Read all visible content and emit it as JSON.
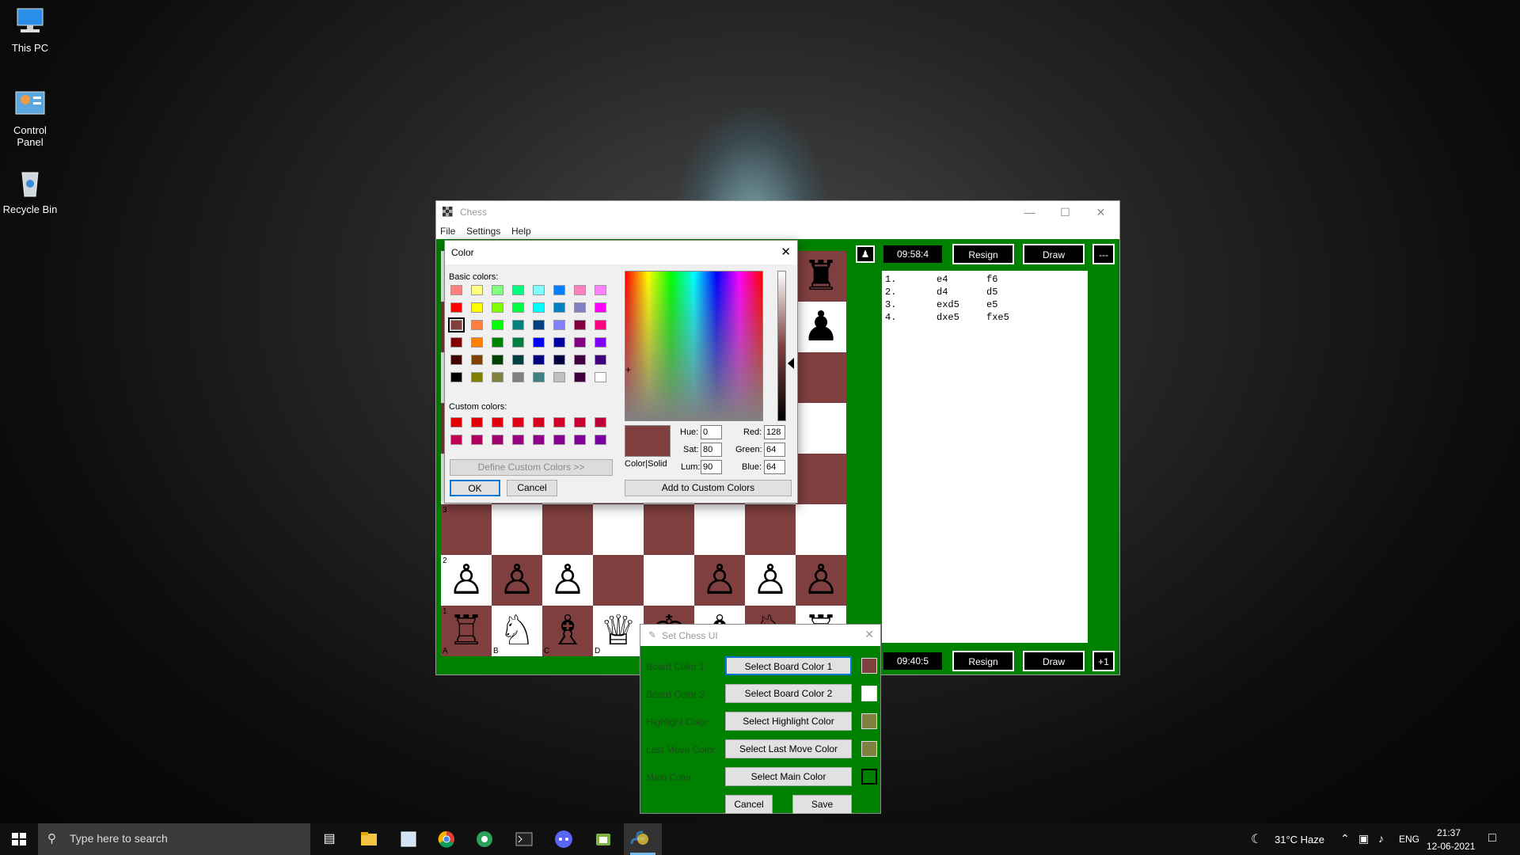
{
  "desktop": {
    "icons": [
      {
        "label": "This PC"
      },
      {
        "label": "Control Panel"
      },
      {
        "label": "Recycle Bin"
      }
    ]
  },
  "chess_window": {
    "title": "Chess",
    "menu": [
      "File",
      "Settings",
      "Help"
    ],
    "top_player": {
      "timer": "09:58:4",
      "resign": "Resign",
      "draw": "Draw",
      "extra": "---"
    },
    "bottom_player": {
      "timer": "09:40:5",
      "resign": "Resign",
      "draw": "Draw",
      "extra": "+1"
    },
    "moves": [
      {
        "num": "1.",
        "white": "e4",
        "black": "f6"
      },
      {
        "num": "2.",
        "white": "d4",
        "black": "d5"
      },
      {
        "num": "3.",
        "white": "exd5",
        "black": "e5"
      },
      {
        "num": "4.",
        "white": "dxe5",
        "black": "fxe5"
      }
    ],
    "board": {
      "dark_color": "#7f3f3f",
      "light_color": "#ffffff",
      "rank_labels": {
        "r3": "3",
        "r2": "2",
        "r1": "1"
      },
      "file_labels": {
        "a": "A",
        "b": "B",
        "c": "C",
        "d": "D"
      }
    }
  },
  "color_dialog": {
    "title": "Color",
    "basic_colors_label": "Basic colors:",
    "custom_colors_label": "Custom colors:",
    "define_custom": "Define Custom Colors >>",
    "ok": "OK",
    "cancel": "Cancel",
    "color_solid": "Color|Solid",
    "add_custom": "Add to Custom Colors",
    "hue_label": "Hue:",
    "hue": "0",
    "sat_label": "Sat:",
    "sat": "80",
    "lum_label": "Lum:",
    "lum": "90",
    "red_label": "Red:",
    "red": "128",
    "green_label": "Green:",
    "green": "64",
    "blue_label": "Blue:",
    "blue": "64",
    "selected_color": "#804040",
    "basic_colors": [
      "#ff8080",
      "#ffff80",
      "#80ff80",
      "#00ff80",
      "#80ffff",
      "#0080ff",
      "#ff80c0",
      "#ff80ff",
      "#ff0000",
      "#ffff00",
      "#80ff00",
      "#00ff40",
      "#00ffff",
      "#0080c0",
      "#8080c0",
      "#ff00ff",
      "#804040",
      "#ff8040",
      "#00ff00",
      "#008080",
      "#004080",
      "#8080ff",
      "#800040",
      "#ff0080",
      "#800000",
      "#ff8000",
      "#008000",
      "#008040",
      "#0000ff",
      "#0000a0",
      "#800080",
      "#8000ff",
      "#400000",
      "#804000",
      "#004000",
      "#004040",
      "#000080",
      "#000040",
      "#400040",
      "#400080",
      "#000000",
      "#808000",
      "#808040",
      "#808080",
      "#408080",
      "#c0c0c0",
      "#400040",
      "#ffffff"
    ],
    "custom_colors": [
      "#e00000",
      "#e00008",
      "#e00010",
      "#e00018",
      "#d80020",
      "#d00028",
      "#c80030",
      "#c00038",
      "#c00050",
      "#b00060",
      "#a00070",
      "#980080",
      "#900088",
      "#880090",
      "#800098",
      "#7800a0"
    ]
  },
  "set_ui_dialog": {
    "title": "Set Chess UI",
    "rows": [
      {
        "label": "Board Color 1",
        "button": "Select Board Color 1",
        "color": "#7f3f3f"
      },
      {
        "label": "Board Color 2",
        "button": "Select Board Color 2",
        "color": "#ffffff"
      },
      {
        "label": "Highlight Color",
        "button": "Select Highlight Color",
        "color": "#808040"
      },
      {
        "label": "Last Move Color",
        "button": "Select Last Move Color",
        "color": "#808040"
      },
      {
        "label": "Main Color",
        "button": "Select Main Color",
        "color": "#008000"
      }
    ],
    "cancel": "Cancel",
    "save": "Save"
  },
  "taskbar": {
    "search_placeholder": "Type here to search",
    "weather": "31°C  Haze",
    "language": "ENG",
    "time": "21:37",
    "date": "12-06-2021"
  }
}
